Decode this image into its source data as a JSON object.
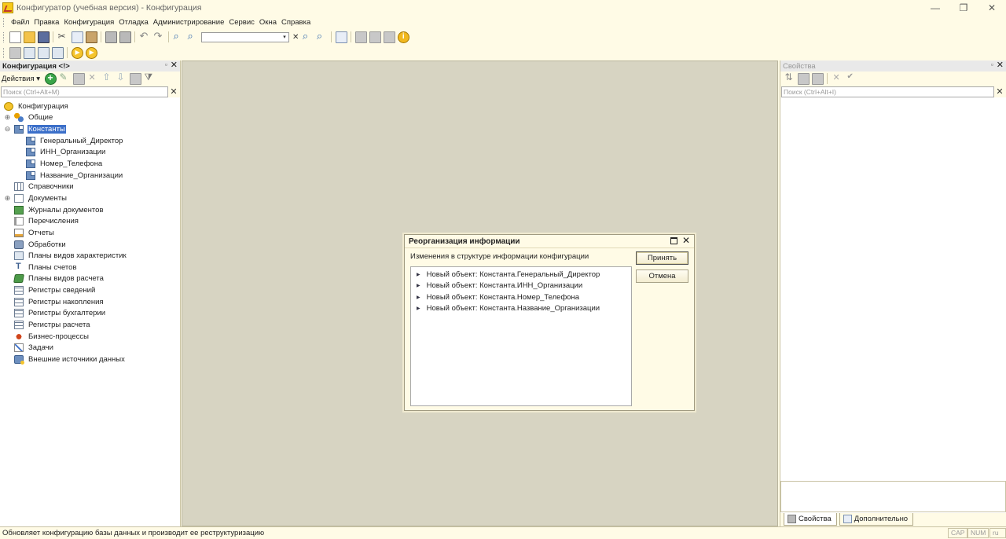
{
  "window": {
    "title": "Конфигуратор (учебная версия) - Конфигурация",
    "controls": [
      "—",
      "❐",
      "✕"
    ]
  },
  "menu": [
    {
      "label": "Файл"
    },
    {
      "label": "Правка"
    },
    {
      "label": "Конфигурация"
    },
    {
      "label": "Отладка"
    },
    {
      "label": "Администрирование"
    },
    {
      "label": "Сервис"
    },
    {
      "label": "Окна"
    },
    {
      "label": "Справка"
    }
  ],
  "toolbar": {
    "search_value": "",
    "dropdown_arrow": "▾",
    "clear_symbol": "✕"
  },
  "left_panel": {
    "title": "Конфигурация <!>",
    "pin": "▫",
    "close": "✕",
    "actions_label": "Действия ▾",
    "search_placeholder": "Поиск (Ctrl+Alt+M)",
    "search_clear": "✕",
    "tree": [
      {
        "label": "Конфигурация",
        "icon": "config",
        "expander": "",
        "level": 0,
        "selected": false
      },
      {
        "label": "Общие",
        "icon": "common",
        "expander": "⊕",
        "level": 1,
        "selected": false
      },
      {
        "label": "Константы",
        "icon": "const",
        "expander": "⊖",
        "level": 1,
        "selected": true
      },
      {
        "label": "Генеральный_Директор",
        "icon": "const",
        "expander": "",
        "level": 2,
        "selected": false
      },
      {
        "label": "ИНН_Организации",
        "icon": "const",
        "expander": "",
        "level": 2,
        "selected": false
      },
      {
        "label": "Номер_Телефона",
        "icon": "const",
        "expander": "",
        "level": 2,
        "selected": false
      },
      {
        "label": "Название_Организации",
        "icon": "const",
        "expander": "",
        "level": 2,
        "selected": false
      },
      {
        "label": "Справочники",
        "icon": "catalog",
        "expander": "",
        "level": 1,
        "selected": false
      },
      {
        "label": "Документы",
        "icon": "doc",
        "expander": "⊕",
        "level": 1,
        "selected": false
      },
      {
        "label": "Журналы документов",
        "icon": "journal",
        "expander": "",
        "level": 1,
        "selected": false
      },
      {
        "label": "Перечисления",
        "icon": "enum",
        "expander": "",
        "level": 1,
        "selected": false
      },
      {
        "label": "Отчеты",
        "icon": "report",
        "expander": "",
        "level": 1,
        "selected": false
      },
      {
        "label": "Обработки",
        "icon": "process",
        "expander": "",
        "level": 1,
        "selected": false
      },
      {
        "label": "Планы видов характеристик",
        "icon": "chars",
        "expander": "",
        "level": 1,
        "selected": false
      },
      {
        "label": "Планы счетов",
        "icon": "accounts",
        "expander": "",
        "level": 1,
        "selected": false
      },
      {
        "label": "Планы видов расчета",
        "icon": "calc",
        "expander": "",
        "level": 1,
        "selected": false
      },
      {
        "label": "Регистры сведений",
        "icon": "reg",
        "expander": "",
        "level": 1,
        "selected": false
      },
      {
        "label": "Регистры накопления",
        "icon": "reg",
        "expander": "",
        "level": 1,
        "selected": false
      },
      {
        "label": "Регистры бухгалтерии",
        "icon": "reg",
        "expander": "",
        "level": 1,
        "selected": false
      },
      {
        "label": "Регистры расчета",
        "icon": "reg",
        "expander": "",
        "level": 1,
        "selected": false
      },
      {
        "label": "Бизнес-процессы",
        "icon": "bproc",
        "expander": "",
        "level": 1,
        "selected": false
      },
      {
        "label": "Задачи",
        "icon": "task",
        "expander": "",
        "level": 1,
        "selected": false
      },
      {
        "label": "Внешние источники данных",
        "icon": "ext",
        "expander": "",
        "level": 1,
        "selected": false
      }
    ]
  },
  "right_panel": {
    "title": "Свойства",
    "pin": "▫",
    "close": "✕",
    "search_placeholder": "Поиск (Ctrl+Alt+I)",
    "search_clear": "✕",
    "tabs": [
      {
        "label": "Свойства",
        "active": true
      },
      {
        "label": "Дополнительно",
        "active": false
      }
    ]
  },
  "dialog": {
    "title": "Реорганизация информации",
    "close": "✕",
    "caption": "Изменения в структуре информации конфигурации",
    "items": [
      "Новый объект: Константа.Генеральный_Директор",
      "Новый объект: Константа.ИНН_Организации",
      "Новый объект: Константа.Номер_Телефона",
      "Новый объект: Константа.Название_Организации"
    ],
    "accept_label": "Принять",
    "cancel_label": "Отмена"
  },
  "statusbar": {
    "message": "Обновляет конфигурацию базы данных и производит ее реструктуризацию",
    "indicators": [
      "CAP",
      "NUM",
      "ru ▾"
    ]
  }
}
